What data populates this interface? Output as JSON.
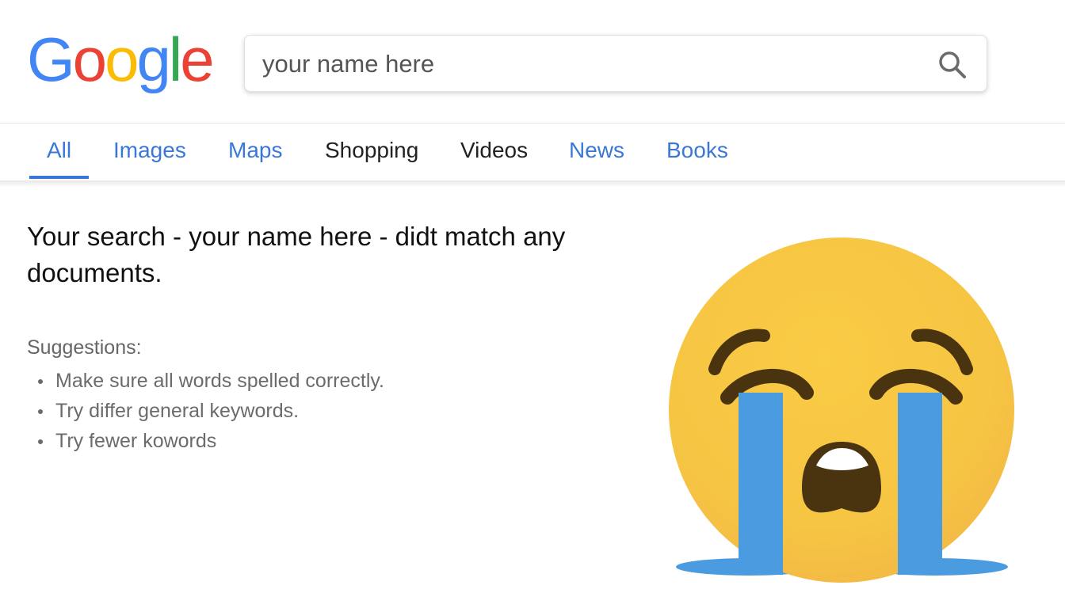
{
  "header": {
    "logo": {
      "letters": [
        "G",
        "o",
        "o",
        "g",
        "l",
        "e"
      ],
      "colors": [
        "#4285F4",
        "#EA4335",
        "#FBBC05",
        "#4285F4",
        "#34A853",
        "#EA4335"
      ]
    },
    "search": {
      "value": "your name here",
      "icon": "search-icon"
    }
  },
  "tabs": [
    {
      "label": "All",
      "active": true,
      "color": "#3a78d8"
    },
    {
      "label": "Images",
      "active": false,
      "color": "#3a78d8"
    },
    {
      "label": "Maps",
      "active": false,
      "color": "#3a78d8"
    },
    {
      "label": "Shopping",
      "active": false,
      "color": "#222222"
    },
    {
      "label": "Videos",
      "active": false,
      "color": "#222222"
    },
    {
      "label": "News",
      "active": false,
      "color": "#3a78d8"
    },
    {
      "label": "Books",
      "active": false,
      "color": "#3a78d8"
    }
  ],
  "results": {
    "message": "Your search - your name here - didt match any documents.",
    "suggestions_title": "Suggestions:",
    "suggestions": [
      "Make sure all words spelled correctly.",
      "Try differ general keywords.",
      "Try fewer kowords"
    ]
  },
  "illustration": {
    "icon": "loudly-crying-face-icon",
    "face_color": "#F6C543",
    "tear_color": "#4A9BE0",
    "feature_color": "#4A3410"
  }
}
